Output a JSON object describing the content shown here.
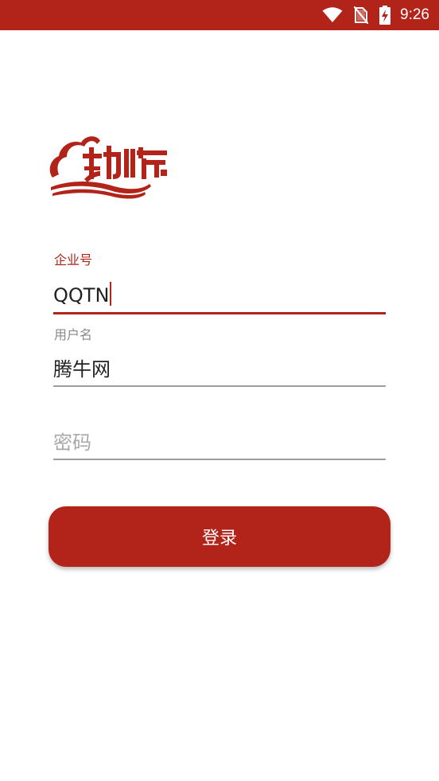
{
  "status_bar": {
    "time": "9:26",
    "icons": [
      "wifi-icon",
      "no-sim-icon",
      "battery-charging-icon"
    ]
  },
  "logo": {
    "name": "logo-icon",
    "color": "#b2231a"
  },
  "form": {
    "company": {
      "label": "企业号",
      "value": "QQTN"
    },
    "username": {
      "label": "用户名",
      "value": "腾牛网"
    },
    "password": {
      "placeholder": "密码",
      "value": ""
    }
  },
  "login_button": {
    "label": "登录"
  },
  "colors": {
    "accent": "#b2231a",
    "inactive_line": "#9e9e9e",
    "label_gray": "#8a8a8a"
  }
}
